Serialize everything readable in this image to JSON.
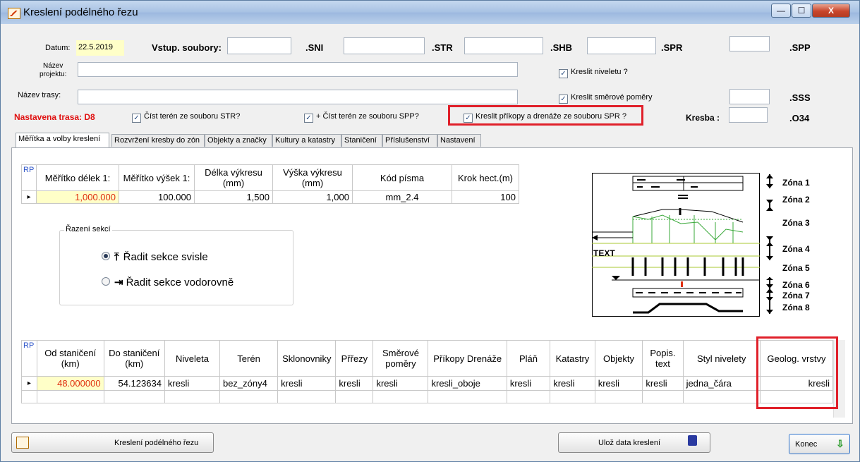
{
  "window": {
    "title": "Kreslení podélného řezu",
    "close_glyph": "X",
    "min_glyph": "—",
    "max_glyph": "☐"
  },
  "top_form": {
    "datum_label": "Datum:",
    "datum_value": "22.5.2019",
    "vstup_label": "Vstup. soubory:",
    "ext_sni": ".SNI",
    "ext_str": ".STR",
    "ext_shb": ".SHB",
    "ext_spr": ".SPR",
    "ext_spp": ".SPP",
    "ext_sss": ".SSS",
    "ext_o34": ".O34",
    "nazev_projektu_label_1": "Název",
    "nazev_projektu_label_2": "projektu:",
    "nazev_trasy_label": "Název trasy:",
    "kreslit_niveletu": "Kreslit niveletu ?",
    "kreslit_smerove": "Kreslit směrové poměry",
    "nastavena_trasa": "Nastavena trasa: D8",
    "cist_teren_str": "Číst terén ze souboru STR?",
    "cist_teren_spp": "+ Číst terén ze souboru SPP?",
    "kreslit_prikopy": "Kreslit příkopy a drenáže ze souboru SPR ?",
    "kresba_label": "Kresba :",
    "check_mark": "✓"
  },
  "tabs": [
    "Měřítka a volby kreslení",
    "Rozvržení kresby do zón",
    "Objekty a značky",
    "Kultury a katastry",
    "Staničení",
    "Příslušenství",
    "Nastavení"
  ],
  "scale_grid": {
    "rp": "RP",
    "headers": [
      "Měřítko délek 1:",
      "Měřítko výšek 1:",
      "Délka výkresu (mm)",
      "Výška výkresu (mm)",
      "Kód písma",
      "Krok hect.(m)"
    ],
    "row": [
      "1,000.000",
      "100.000",
      "1,500",
      "1,000",
      "mm_2.4",
      "100"
    ],
    "row_marker": "▸"
  },
  "razeni": {
    "legend": "Řazení sekcí",
    "opt1": "Řadit sekce svisle",
    "opt2": "Řadit sekce vodorovně",
    "opt1_icon": "⤒",
    "opt2_icon": "⇥"
  },
  "zones": [
    "Zóna 1",
    "Zóna 2",
    "Zóna 3",
    "Zóna 4",
    "Zóna 5",
    "Zóna 6",
    "Zóna 7",
    "Zóna 8"
  ],
  "diagram_text": "TEXT",
  "sections_grid": {
    "rp": "RP",
    "headers": [
      "Od staničení (km)",
      "Do staničení (km)",
      "Niveleta",
      "Terén",
      "Sklonovniky",
      "Přřezy",
      "Směrové poměry",
      "Příkopy Drenáže",
      "Pláň",
      "Katastry",
      "Objekty",
      "Popis. text",
      "Styl nivelety",
      "Geolog. vrstvy"
    ],
    "row": [
      "48.000000",
      "54.123634",
      "kresli",
      "bez_zóny4",
      "kresli",
      "kresli",
      "kresli",
      "kresli_oboje",
      "kresli",
      "kresli",
      "kresli",
      "kresli",
      "jedna_čára",
      "kresli"
    ],
    "row_marker": "▸"
  },
  "buttons": {
    "kresleni": "Kreslení podélného řezu",
    "uloz": "Ulož data kreslení",
    "konec": "Konec",
    "konec_icon": "⇩",
    "save_icon": "💾"
  },
  "colors": {
    "highlight_red": "#e0202a",
    "yellow_field": "#ffffc8",
    "red_text": "#e03010"
  }
}
